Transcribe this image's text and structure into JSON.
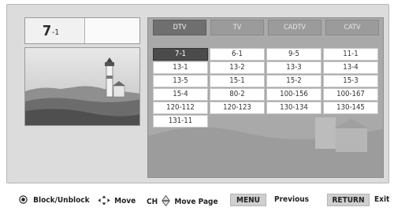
{
  "current_channel": {
    "major": "7",
    "minor": "-1"
  },
  "tabs": [
    {
      "label": "DTV",
      "active": true
    },
    {
      "label": "TV",
      "active": false
    },
    {
      "label": "CADTV",
      "active": false
    },
    {
      "label": "CATV",
      "active": false
    }
  ],
  "channels": [
    {
      "label": "7-1",
      "selected": true
    },
    {
      "label": "6-1",
      "selected": false
    },
    {
      "label": "9-5",
      "selected": false
    },
    {
      "label": "11-1",
      "selected": false
    },
    {
      "label": "13-1",
      "selected": false
    },
    {
      "label": "13-2",
      "selected": false
    },
    {
      "label": "13-3",
      "selected": false
    },
    {
      "label": "13-4",
      "selected": false
    },
    {
      "label": "13-5",
      "selected": false
    },
    {
      "label": "15-1",
      "selected": false
    },
    {
      "label": "15-2",
      "selected": false
    },
    {
      "label": "15-3",
      "selected": false
    },
    {
      "label": "15-4",
      "selected": false
    },
    {
      "label": "80-2",
      "selected": false
    },
    {
      "label": "100-156",
      "selected": false
    },
    {
      "label": "100-167",
      "selected": false
    },
    {
      "label": "120-112",
      "selected": false
    },
    {
      "label": "120-123",
      "selected": false
    },
    {
      "label": "130-134",
      "selected": false
    },
    {
      "label": "130-145",
      "selected": false
    },
    {
      "label": "131-11",
      "selected": false
    }
  ],
  "footer": {
    "block_label": "Block/Unblock",
    "move_label": "Move",
    "ch_label": "CH",
    "move_page_label": "Move Page",
    "menu_key": "MENU",
    "previous_label": "Previous",
    "return_key": "RETURN",
    "exit_label": "Exit"
  },
  "colors": {
    "selected_cell": "#4b4b4b",
    "active_tab": "#6f6f6f",
    "panel_bg": "#a9a9a9"
  },
  "icons": [
    "enter-button-icon",
    "four-way-arrows-icon",
    "up-down-diamond-icon",
    "lighthouse-image"
  ]
}
